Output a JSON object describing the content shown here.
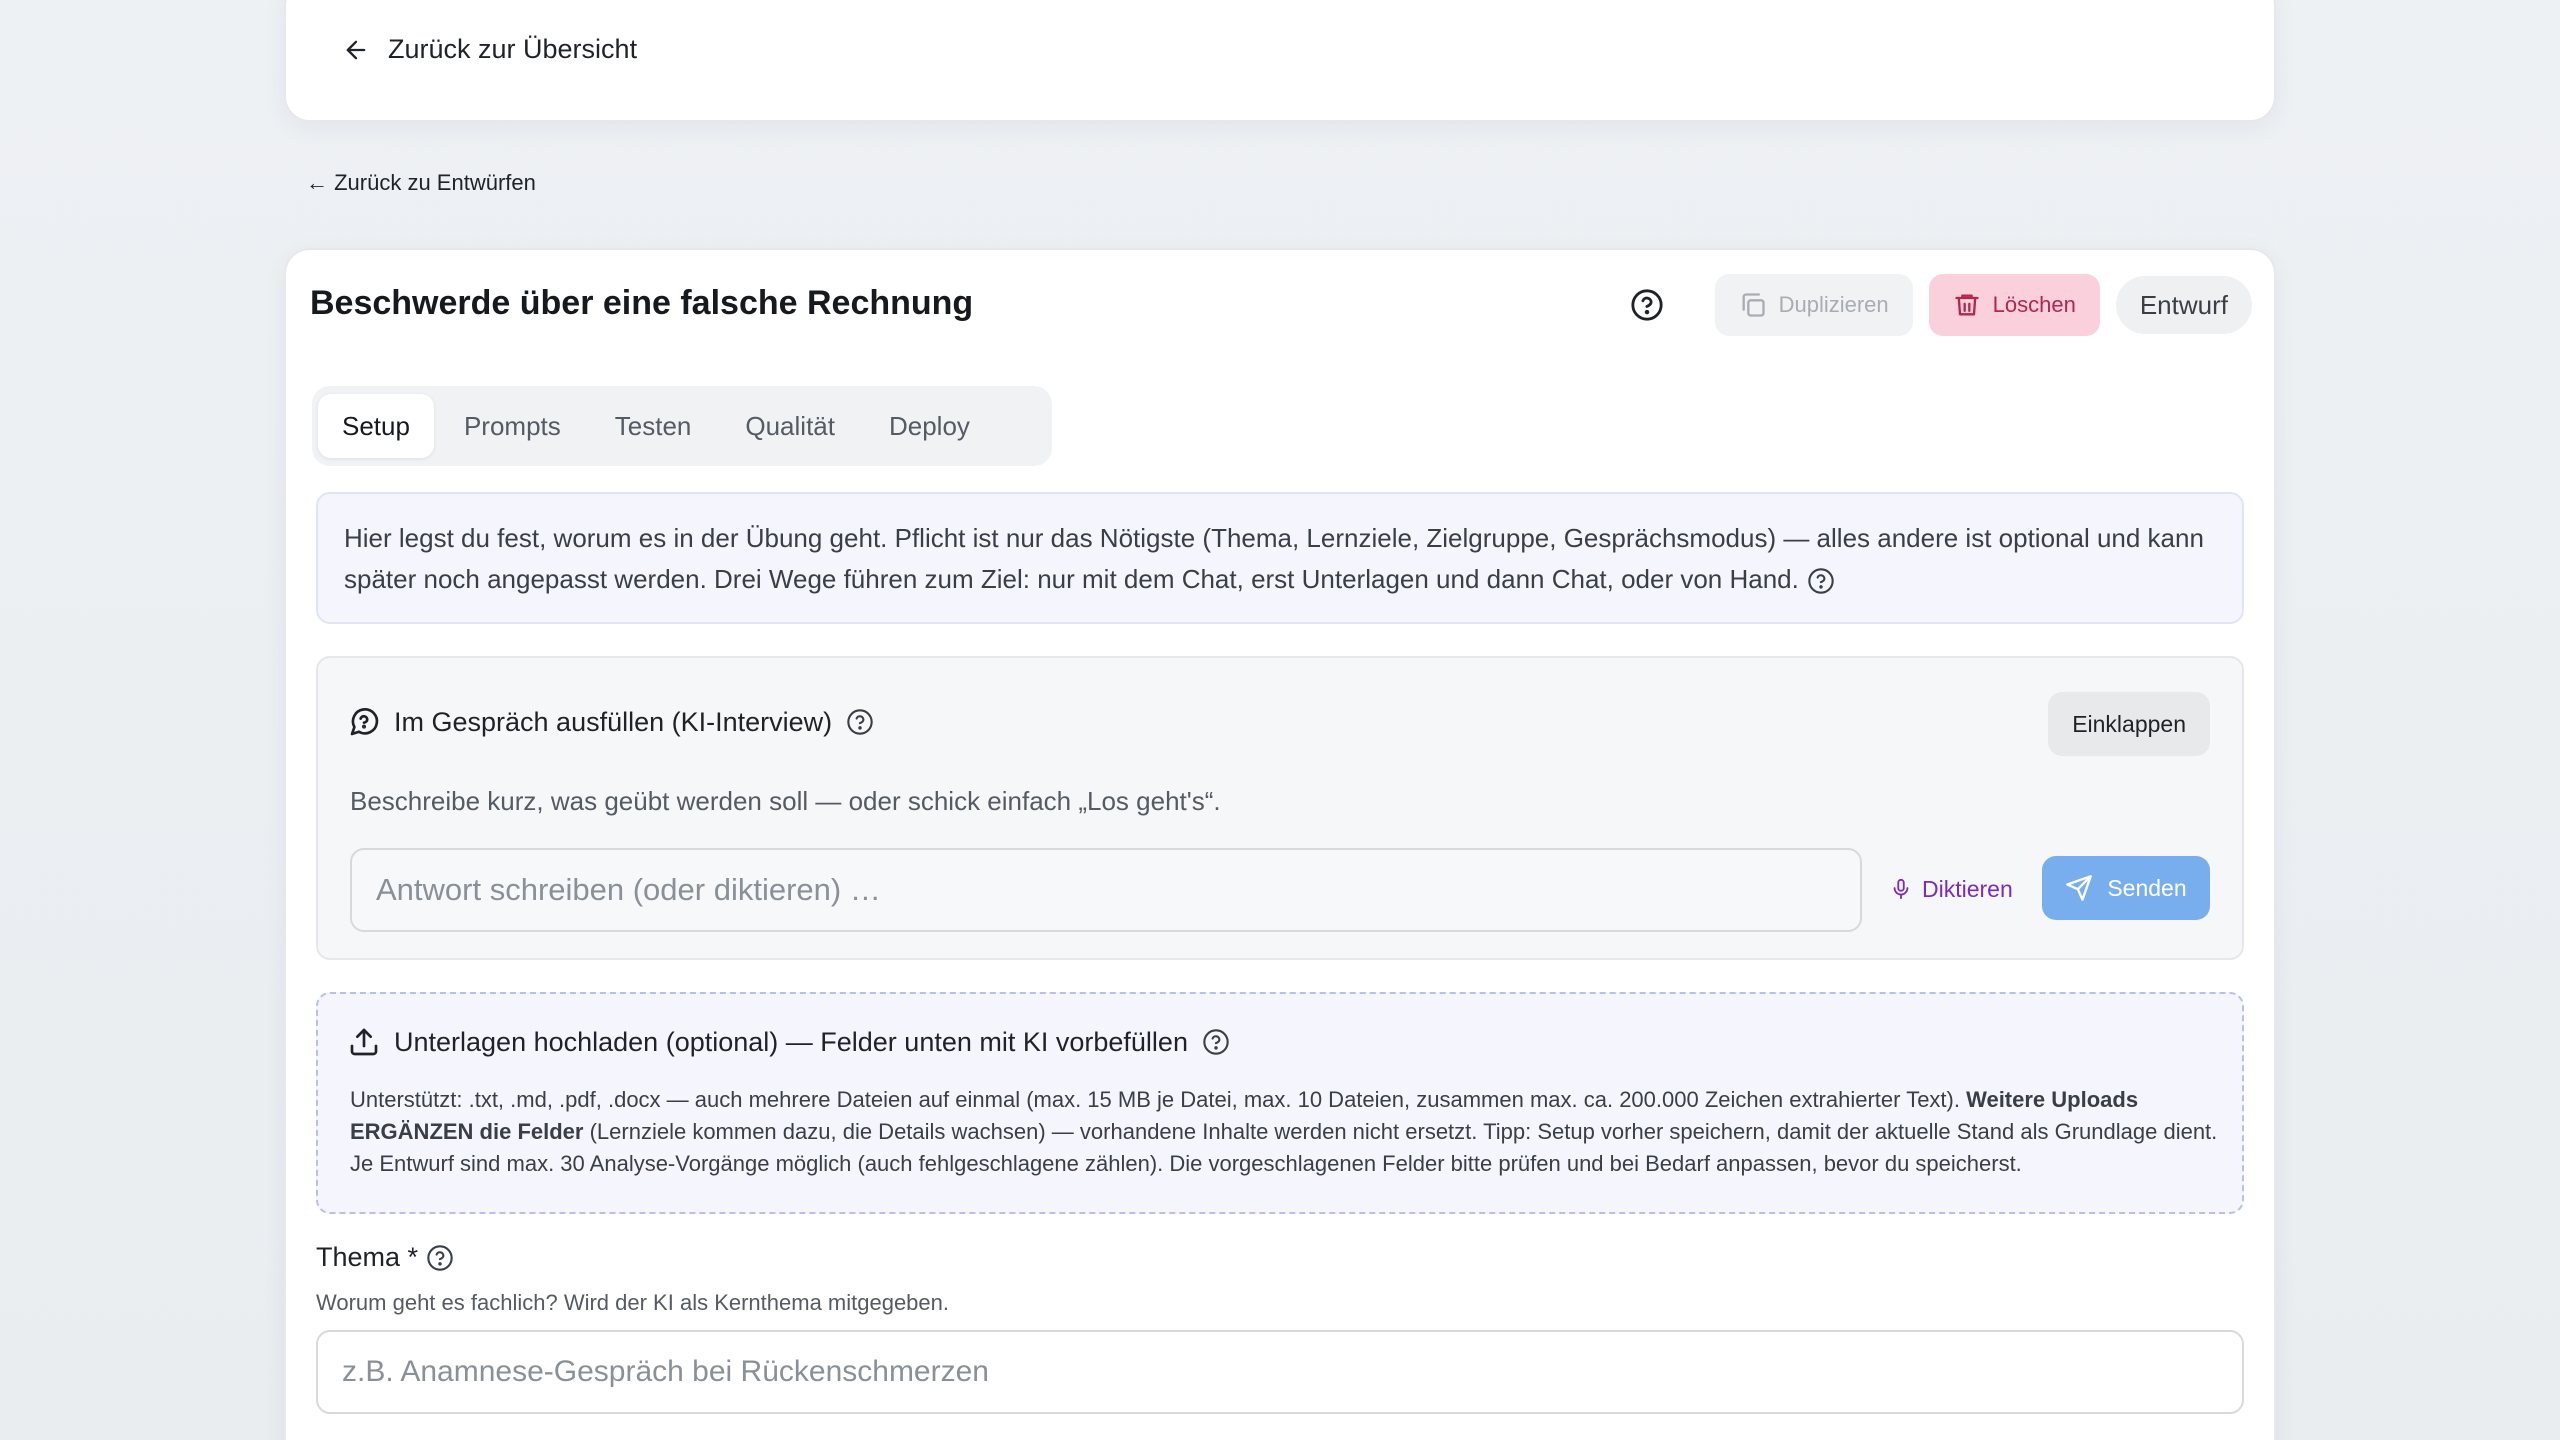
{
  "nav": {
    "back_overview": "Zurück zur Übersicht",
    "back_drafts": "← Zurück zu Entwürfen"
  },
  "header": {
    "title": "Beschwerde über eine falsche Rechnung",
    "duplicate_label": "Duplizieren",
    "delete_label": "Löschen",
    "status": "Entwurf"
  },
  "tabs": [
    {
      "label": "Setup",
      "active": true
    },
    {
      "label": "Prompts",
      "active": false
    },
    {
      "label": "Testen",
      "active": false
    },
    {
      "label": "Qualität",
      "active": false
    },
    {
      "label": "Deploy",
      "active": false
    }
  ],
  "info_text": "Hier legst du fest, worum es in der Übung geht. Pflicht ist nur das Nötigste (Thema, Lernziele, Zielgruppe, Gesprächsmodus) — alles andere ist optional und kann später noch angepasst werden. Drei Wege führen zum Ziel: nur mit dem Chat, erst Unterlagen und dann Chat, oder von Hand.",
  "interview": {
    "title": "Im Gespräch ausfüllen (KI-Interview)",
    "collapse_label": "Einklappen",
    "hint": "Beschreibe kurz, was geübt werden soll — oder schick einfach „Los geht's“.",
    "input_placeholder": "Antwort schreiben (oder diktieren) …",
    "dictate_label": "Diktieren",
    "send_label": "Senden"
  },
  "upload": {
    "title": "Unterlagen hochladen (optional) — Felder unten mit KI vorbefüllen",
    "text_1": "Unterstützt: .txt, .md, .pdf, .docx — auch mehrere Dateien auf einmal (max. 15 MB je Datei, max. 10 Dateien, zusammen max. ca. 200.000 Zeichen extrahierter Text). ",
    "text_bold": "Weitere Uploads ERGÄNZEN die Felder",
    "text_2": " (Lernziele kommen dazu, die Details wachsen) — vorhandene Inhalte werden nicht ersetzt. Tipp: Setup vorher speichern, damit der aktuelle Stand als Grundlage dient. Je Entwurf sind max. 30 Analyse-Vorgänge möglich (auch fehlgeschlagene zählen). Die vorgeschlagenen Felder bitte prüfen und bei Bedarf anpassen, bevor du speicherst."
  },
  "thema": {
    "label": "Thema *",
    "help": "Worum geht es fachlich? Wird der KI als Kernthema mitgegeben.",
    "placeholder": "z.B. Anamnese-Gespräch bei Rückenschmerzen"
  },
  "icons": {
    "back": "arrow-left-icon",
    "help": "question-circle-icon",
    "duplicate": "copy-icon",
    "delete": "trash-icon",
    "chat": "chat-question-icon",
    "mic": "microphone-icon",
    "send": "send-icon",
    "upload": "upload-icon"
  },
  "colors": {
    "delete_bg": "#fbd0dd",
    "delete_text": "#b3264d",
    "send_bg": "#79aeee",
    "dictate_text": "#7b2bbd",
    "info_bg": "#f4f5fd"
  }
}
